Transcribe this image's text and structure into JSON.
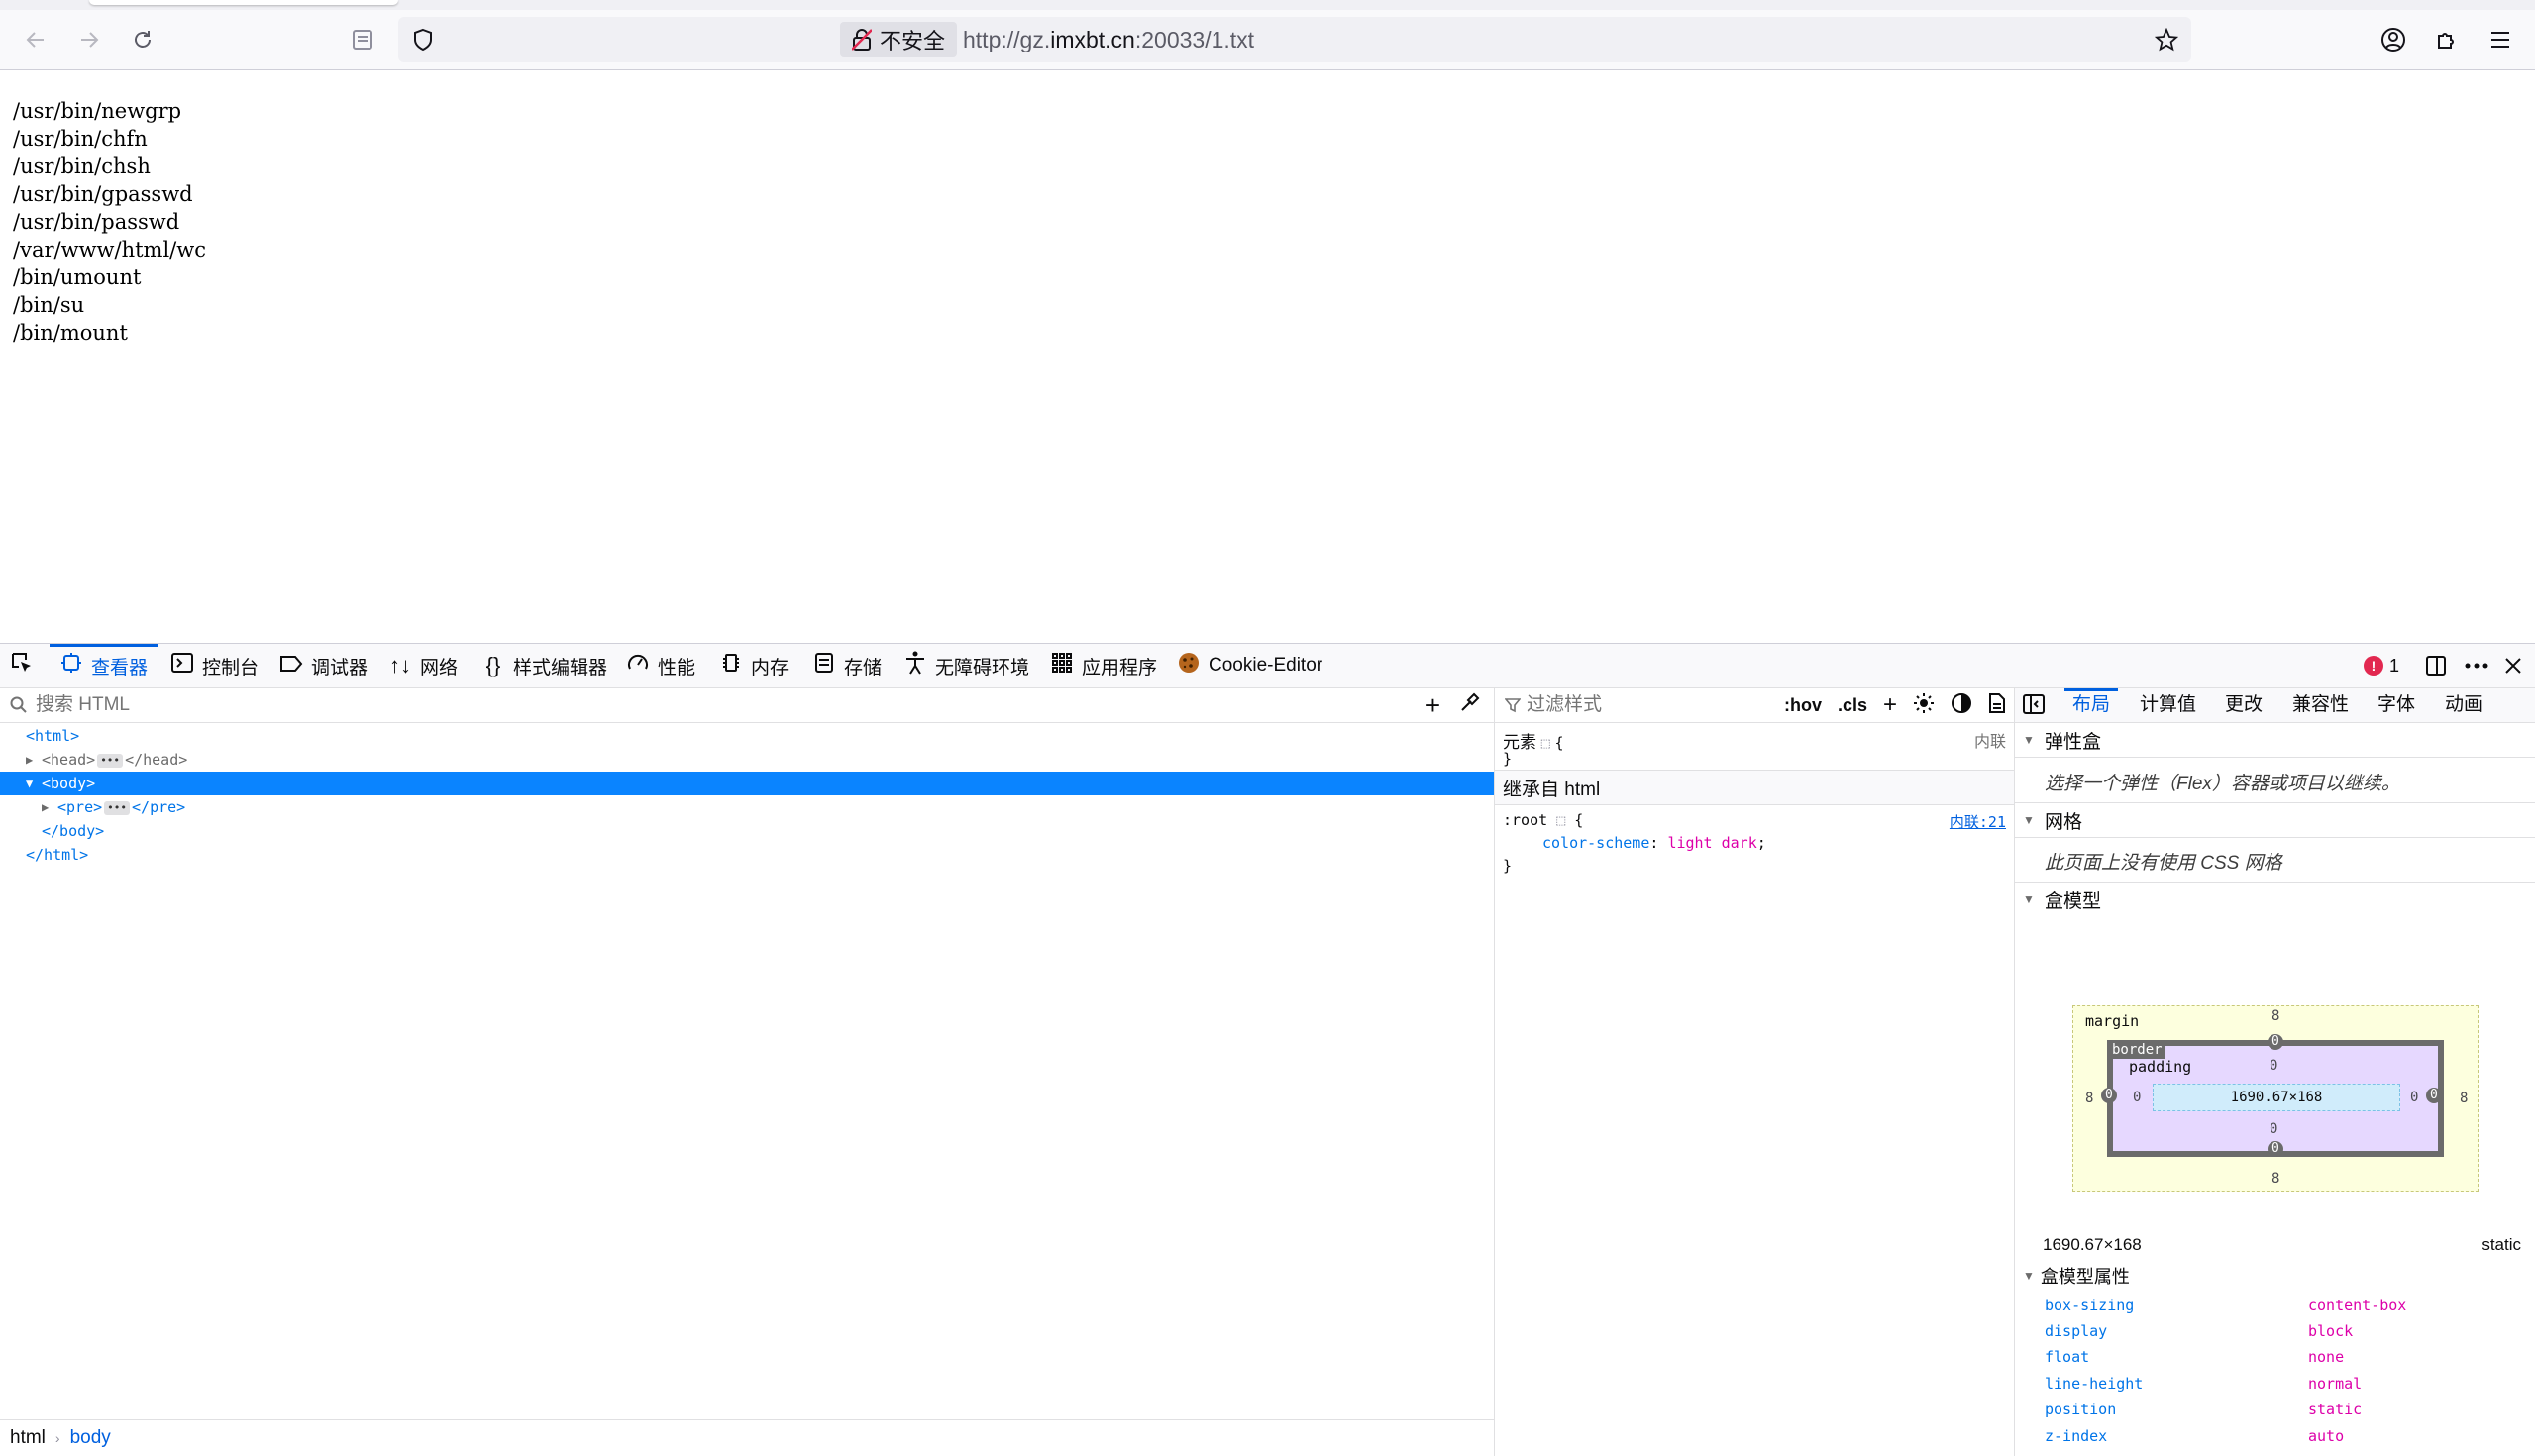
{
  "browser": {
    "security_label": "不安全",
    "url_prefix": "http://gz.",
    "url_domain": "imxbt.cn",
    "url_suffix": ":20033/1.txt"
  },
  "page": {
    "lines": [
      "/usr/bin/newgrp",
      "/usr/bin/chfn",
      "/usr/bin/chsh",
      "/usr/bin/gpasswd",
      "/usr/bin/passwd",
      "/var/www/html/wc",
      "/bin/umount",
      "/bin/su",
      "/bin/mount"
    ]
  },
  "devtools": {
    "tabs": [
      {
        "label": "查看器",
        "icon": "inspector-icon"
      },
      {
        "label": "控制台",
        "icon": "console-icon"
      },
      {
        "label": "调试器",
        "icon": "debugger-icon"
      },
      {
        "label": "网络",
        "icon": "network-icon"
      },
      {
        "label": "样式编辑器",
        "icon": "style-editor-icon"
      },
      {
        "label": "性能",
        "icon": "performance-icon"
      },
      {
        "label": "内存",
        "icon": "memory-icon"
      },
      {
        "label": "存储",
        "icon": "storage-icon"
      },
      {
        "label": "无障碍环境",
        "icon": "accessibility-icon"
      },
      {
        "label": "应用程序",
        "icon": "application-icon"
      },
      {
        "label": "Cookie-Editor",
        "icon": "cookie-icon"
      }
    ],
    "error_count": "1",
    "inspector": {
      "search_placeholder": "搜索 HTML",
      "tree": {
        "html_open": "<html>",
        "head_open": "<head>",
        "head_close": "</head>",
        "body_open": "<body>",
        "pre_open": "<pre>",
        "pre_close": "</pre>",
        "body_close": "</body>",
        "html_close": "</html>"
      },
      "breadcrumbs": [
        "html",
        "body"
      ]
    },
    "rules": {
      "filter_placeholder": "过滤样式",
      "hov_label": ":hov",
      "cls_label": ".cls",
      "element_selector": "元素",
      "element_open": "{",
      "element_close": "}",
      "element_source": "内联",
      "inherited_header": "继承自 html",
      "root_selector": ":root",
      "root_open": "{",
      "root_source": "内联:21",
      "root_property": "color-scheme",
      "root_value": "light dark",
      "root_close": "}"
    },
    "layout": {
      "tabs": [
        "布局",
        "计算值",
        "更改",
        "兼容性",
        "字体",
        "动画"
      ],
      "flex_title": "弹性盒",
      "flex_hint": "选择一个弹性（Flex）容器或项目以继续。",
      "grid_title": "网格",
      "grid_hint": "此页面上没有使用 CSS 网格",
      "boxmodel_title": "盒模型",
      "boxmodel": {
        "margin_label": "margin",
        "border_label": "border",
        "padding_label": "padding",
        "margin_top": "8",
        "margin_bottom": "8",
        "margin_left": "8",
        "margin_right": "8",
        "border_top": "0",
        "border_bottom": "0",
        "border_left": "0",
        "border_right": "0",
        "padding_top": "0",
        "padding_bottom": "0",
        "padding_left": "0",
        "padding_right": "0",
        "content_size": "1690.67×168"
      },
      "dimensions": "1690.67×168",
      "position_value": "static",
      "props_title": "盒模型属性",
      "props": [
        {
          "name": "box-sizing",
          "value": "content-box"
        },
        {
          "name": "display",
          "value": "block"
        },
        {
          "name": "float",
          "value": "none"
        },
        {
          "name": "line-height",
          "value": "normal"
        },
        {
          "name": "position",
          "value": "static"
        },
        {
          "name": "z-index",
          "value": "auto"
        }
      ]
    }
  },
  "colors": {
    "accent": "#0060df",
    "selection": "#0a84ff",
    "property": "#0074e8",
    "value": "#dd00a9",
    "error": "#e22850"
  }
}
